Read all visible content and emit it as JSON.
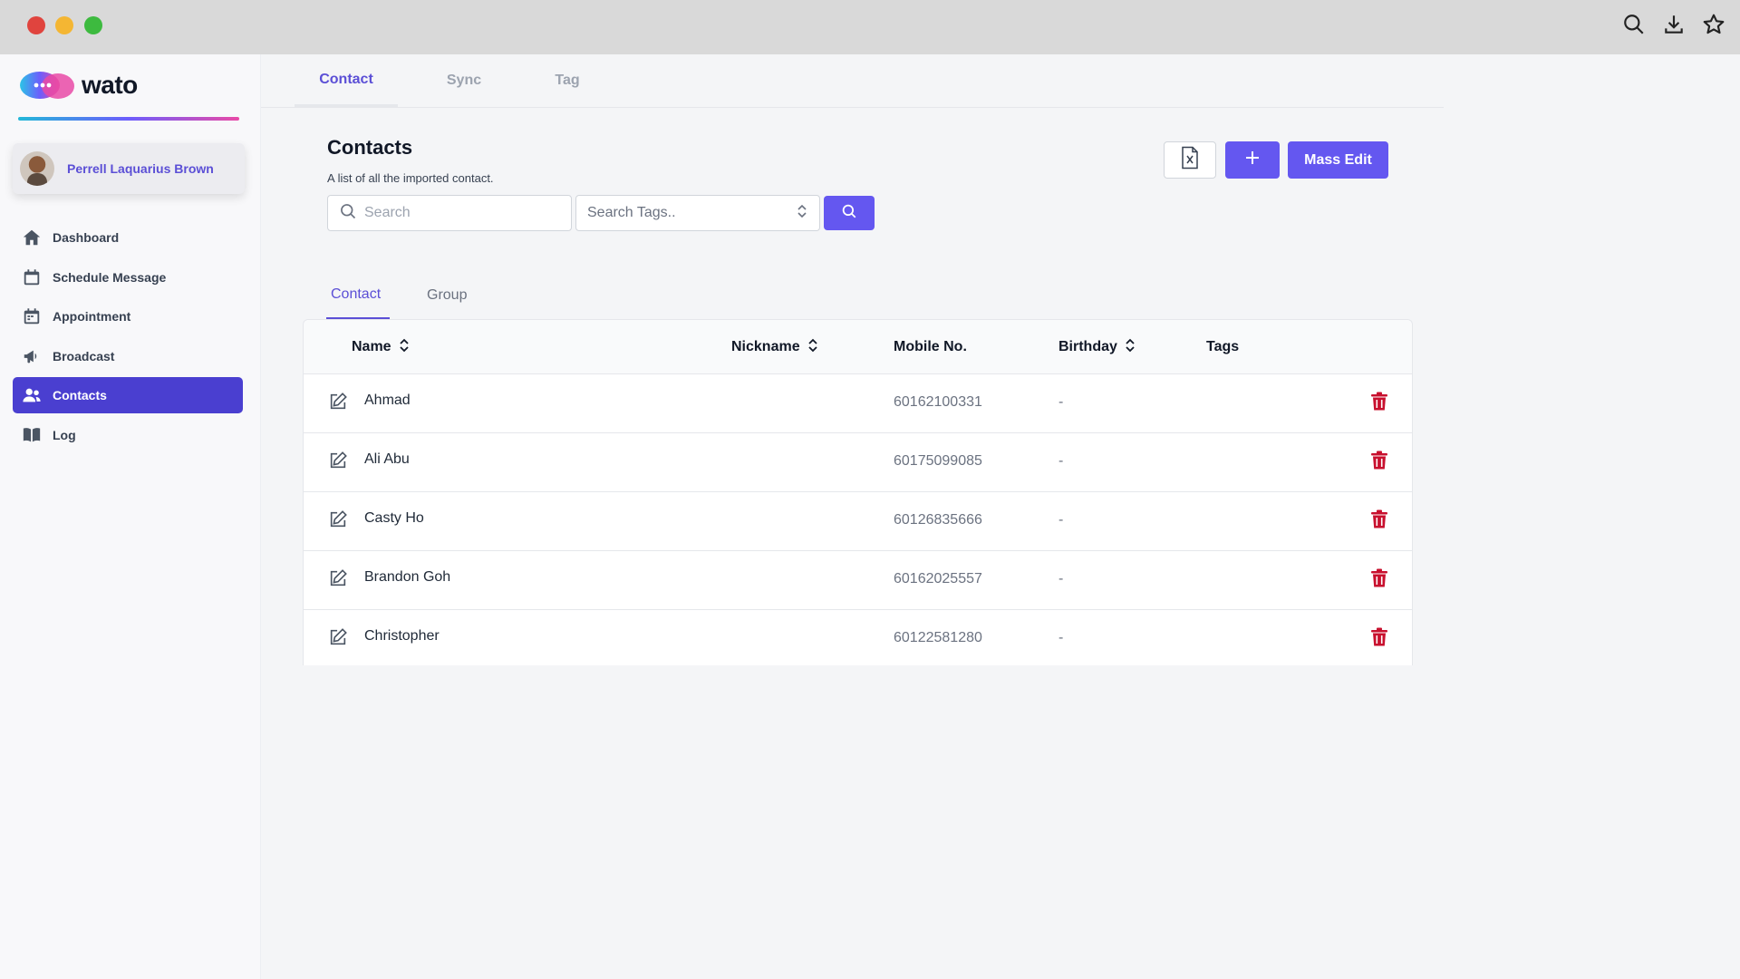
{
  "colors": {
    "accent": "#6457f0",
    "accent_dark": "#4a3fd0",
    "danger": "#c8102e"
  },
  "brand": {
    "name": "wato"
  },
  "user": {
    "name": "Perrell Laquarius Brown"
  },
  "sidebar": {
    "items": [
      {
        "label": "Dashboard",
        "icon": "home-icon"
      },
      {
        "label": "Schedule Message",
        "icon": "calendar-icon"
      },
      {
        "label": "Appointment",
        "icon": "calendar-icon"
      },
      {
        "label": "Broadcast",
        "icon": "megaphone-icon"
      },
      {
        "label": "Contacts",
        "icon": "users-icon",
        "active": true
      },
      {
        "label": "Log",
        "icon": "book-icon"
      }
    ]
  },
  "top_tabs": [
    {
      "label": "Contact",
      "active": true
    },
    {
      "label": "Sync"
    },
    {
      "label": "Tag"
    }
  ],
  "header": {
    "title": "Contacts",
    "subtitle": "A list of all the imported contact."
  },
  "search": {
    "placeholder": "Search",
    "value": ""
  },
  "tag_search": {
    "placeholder": "Search Tags.."
  },
  "actions": {
    "mass_edit_label": "Mass Edit"
  },
  "inner_tabs": [
    {
      "label": "Contact",
      "active": true
    },
    {
      "label": "Group"
    }
  ],
  "table": {
    "columns": [
      "Name",
      "Nickname",
      "Mobile No.",
      "Birthday",
      "Tags"
    ],
    "rows": [
      {
        "name": "Ahmad",
        "nickname": "",
        "mobile": "60162100331",
        "birthday": "-",
        "tags": ""
      },
      {
        "name": "Ali Abu",
        "nickname": "",
        "mobile": "60175099085",
        "birthday": "-",
        "tags": ""
      },
      {
        "name": "Casty Ho",
        "nickname": "",
        "mobile": "60126835666",
        "birthday": "-",
        "tags": ""
      },
      {
        "name": "Brandon Goh",
        "nickname": "",
        "mobile": "60162025557",
        "birthday": "-",
        "tags": ""
      },
      {
        "name": "Christopher",
        "nickname": "",
        "mobile": "60122581280",
        "birthday": "-",
        "tags": ""
      }
    ]
  }
}
